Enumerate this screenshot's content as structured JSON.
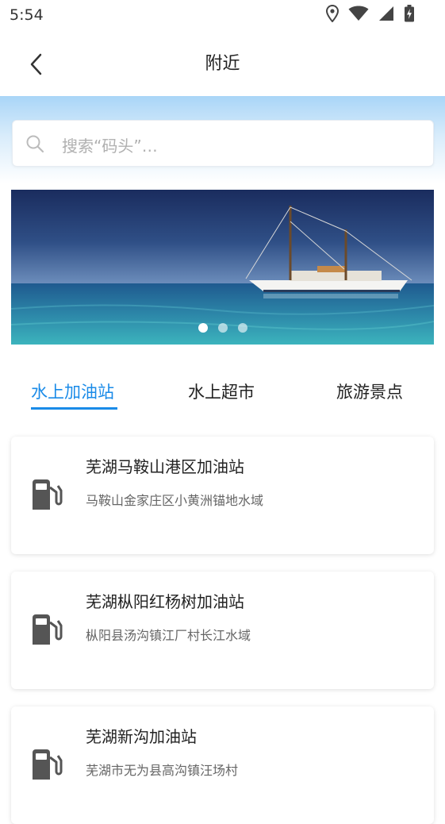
{
  "status": {
    "time": "5:54"
  },
  "header": {
    "title": "附近"
  },
  "search": {
    "placeholder": "搜索“码头”…"
  },
  "banner": {
    "dots": 3,
    "active_dot": 0
  },
  "tabs": [
    {
      "label": "水上加油站",
      "active": true
    },
    {
      "label": "水上超市",
      "active": false
    },
    {
      "label": "旅游景点",
      "active": false
    }
  ],
  "stations": [
    {
      "name": "芜湖马鞍山港区加油站",
      "address": "马鞍山金家庄区小黄洲锚地水域"
    },
    {
      "name": "芜湖枞阳红杨树加油站",
      "address": "枞阳县汤沟镇江厂村长江水域"
    },
    {
      "name": "芜湖新沟加油站",
      "address": "芜湖市无为县高沟镇汪场村"
    }
  ],
  "colors": {
    "accent": "#1a8be8",
    "icon_gray": "#555555"
  },
  "icons": {
    "station": "fuel-pump-icon",
    "back": "back-arrow-icon",
    "search": "search-icon"
  }
}
